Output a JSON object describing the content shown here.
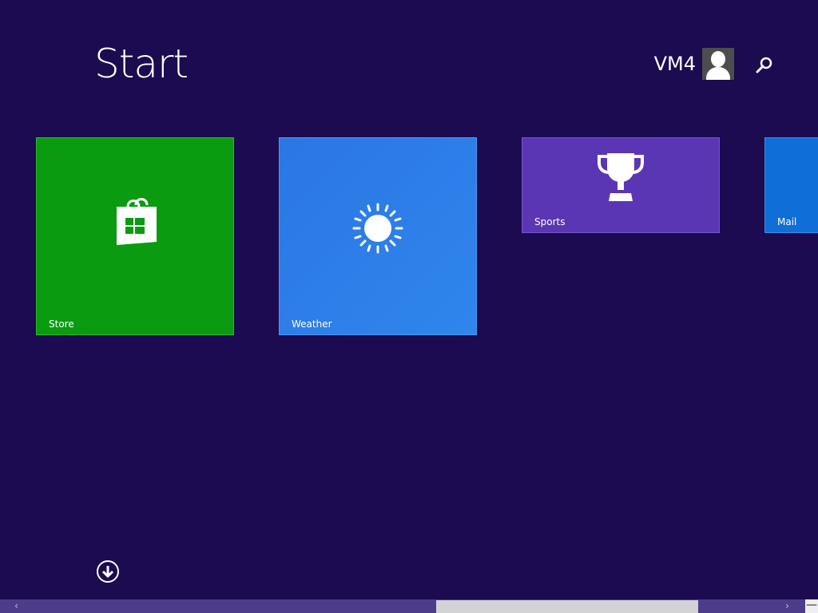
{
  "header": {
    "title": "Start",
    "user_name": "VM4",
    "search_icon": "search-icon"
  },
  "tiles": [
    {
      "label": "Store",
      "icon": "store-bag-icon",
      "color": "#0a9b10"
    },
    {
      "label": "Weather",
      "icon": "sun-icon",
      "color": "#2b76e5"
    },
    {
      "label": "Sports",
      "icon": "trophy-icon",
      "color": "#5b36b4"
    },
    {
      "label": "Mail",
      "icon": "mail-icon",
      "color": "#0f6ed8"
    }
  ],
  "footer": {
    "all_apps_icon": "down-arrow-circle-icon",
    "scroll_left_glyph": "‹",
    "scroll_right_glyph": "›",
    "zoom_glyph": "—"
  },
  "colors": {
    "background": "#1c0b50",
    "scrollbar": "#4d3c8a",
    "scroll_thumb": "#d3d3d6"
  }
}
